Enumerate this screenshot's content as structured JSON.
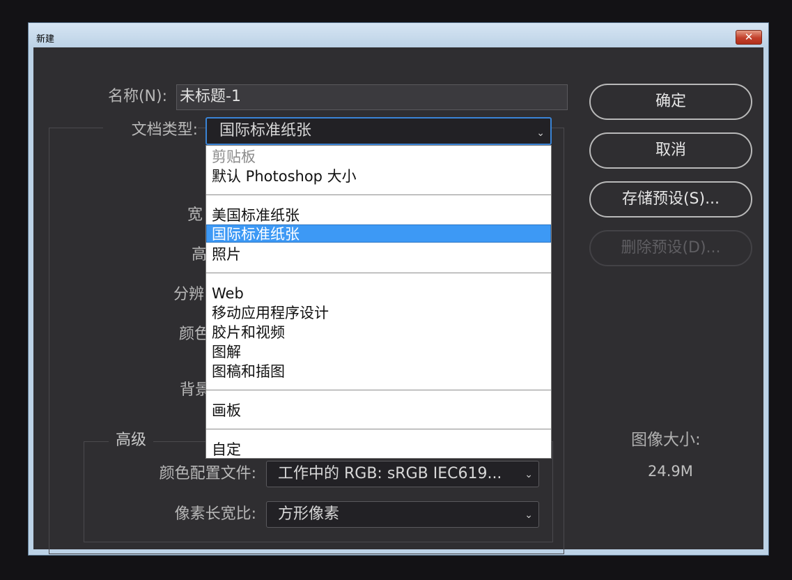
{
  "window": {
    "title": "新建",
    "close_glyph": "✕"
  },
  "form": {
    "name_label": "名称(N):",
    "name_value": "未标题-1",
    "doc_type_label": "文档类型:",
    "doc_type_value": "国际标准纸张",
    "partial_labels": [
      "宽",
      "高",
      "分辨",
      "颜色",
      "背景"
    ]
  },
  "dropdown": {
    "groups": [
      [
        "剪贴板",
        "默认 Photoshop 大小"
      ],
      [
        "美国标准纸张",
        "国际标准纸张",
        "照片"
      ],
      [
        "Web",
        "移动应用程序设计",
        "胶片和视频",
        "图解",
        "图稿和插图"
      ],
      [
        "画板"
      ],
      [
        "自定"
      ]
    ],
    "disabled_item": "剪贴板",
    "selected_item": "国际标准纸张"
  },
  "advanced": {
    "legend": "高级",
    "color_profile_label": "颜色配置文件:",
    "color_profile_value": "工作中的 RGB:  sRGB IEC619...",
    "pixel_aspect_label": "像素长宽比:",
    "pixel_aspect_value": "方形像素"
  },
  "buttons": {
    "ok": "确定",
    "cancel": "取消",
    "save_preset": "存储预设(S)...",
    "delete_preset": "删除预设(D)..."
  },
  "image_size": {
    "label": "图像大小:",
    "value": "24.9M"
  },
  "icons": {
    "chevron": "chevron-down-icon",
    "close": "close-icon"
  },
  "colors": {
    "selection": "#3d99f5",
    "focus": "#3a84d6",
    "dialog_bg": "#2f2e31"
  }
}
